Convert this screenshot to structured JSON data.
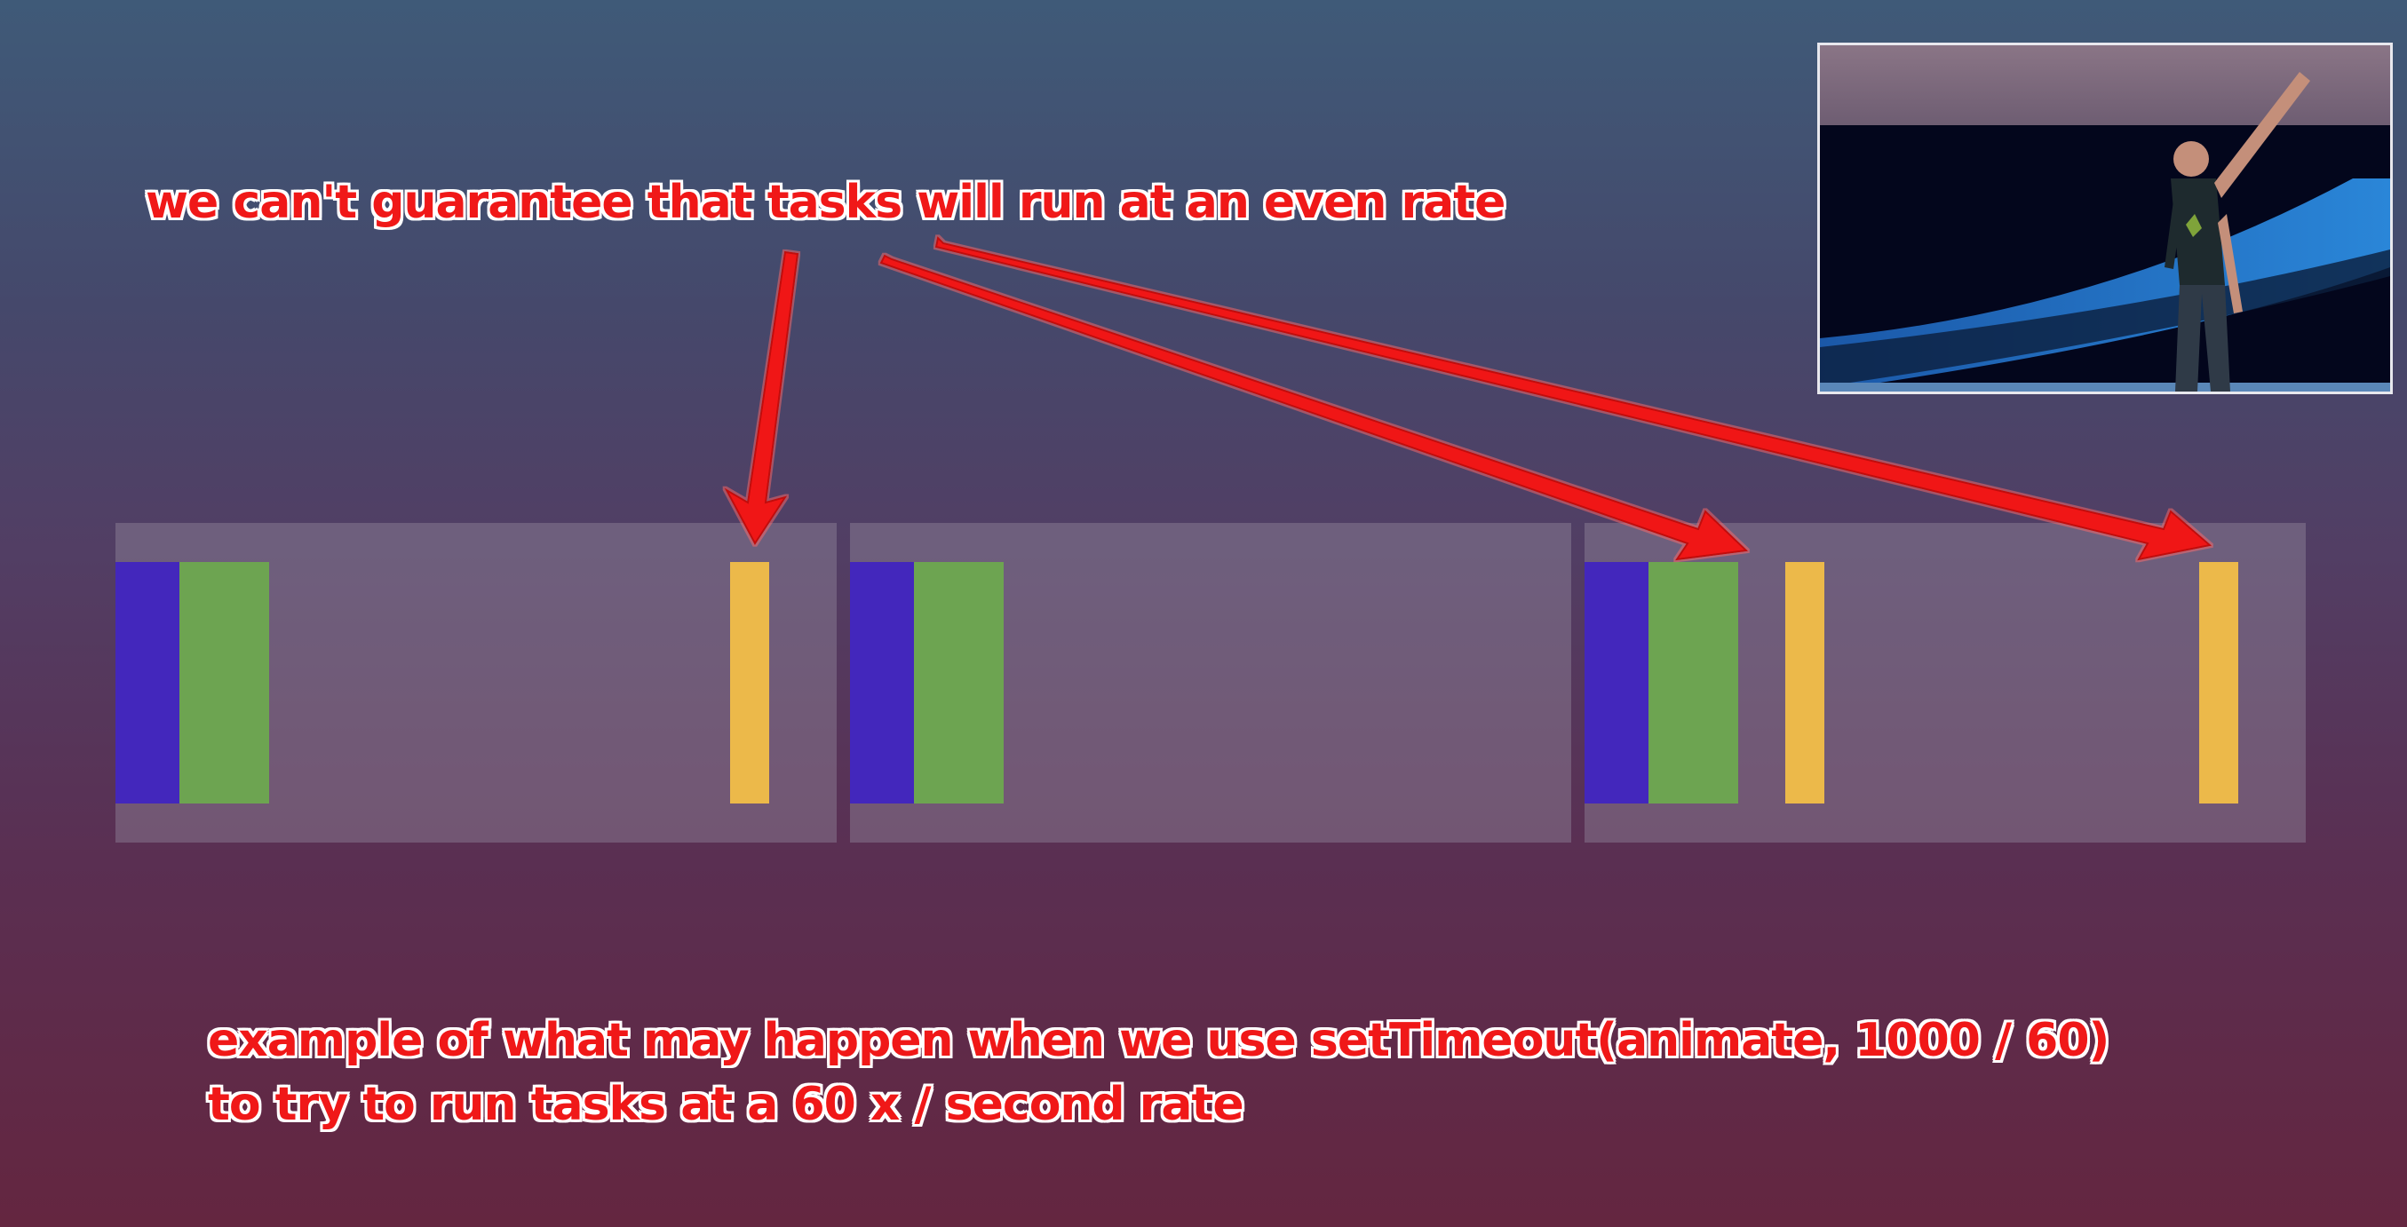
{
  "captions": {
    "top": "we can't guarantee that tasks will run at an even rate",
    "bottom_line1": "example of what may happen when we use setTimeout(animate, 1000 / 60)",
    "bottom_line2": "to try to run tasks at a 60 x / second rate"
  },
  "colors": {
    "annotation": "#f01818",
    "task_purple": "#4327bc",
    "task_green": "#6da451",
    "task_yellow": "#ecb94a",
    "frame": "#8c8296"
  },
  "frames": [
    {
      "tasks": [
        "purple",
        "green",
        "yellow"
      ]
    },
    {
      "tasks": [
        "purple",
        "green"
      ]
    },
    {
      "tasks": [
        "purple",
        "green",
        "yellow",
        "yellow"
      ]
    }
  ],
  "inset": {
    "content": "presenter video inset"
  }
}
